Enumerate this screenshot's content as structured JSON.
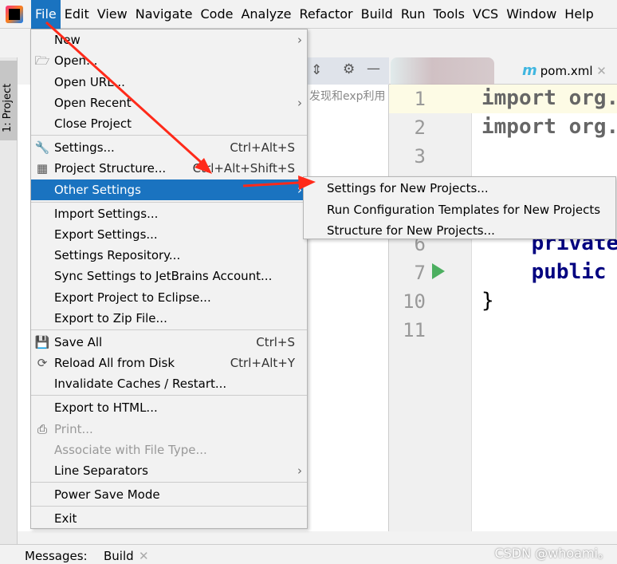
{
  "menubar": [
    "File",
    "Edit",
    "View",
    "Navigate",
    "Code",
    "Analyze",
    "Refactor",
    "Build",
    "Run",
    "Tools",
    "VCS",
    "Window",
    "Help"
  ],
  "sidebar": {
    "project_tab": "1: Project"
  },
  "panel": {
    "partial_text": "发现和exp利用"
  },
  "tabs": {
    "pom": "pom.xml",
    "pom_icon": "m"
  },
  "editor": {
    "line_numbers": [
      "1",
      "2",
      "3",
      "6",
      "7",
      "10",
      "11"
    ],
    "lines": {
      "l1": "import org.",
      "l2": "import org.",
      "l6": "    private",
      "l7": "    public",
      "l10": "}"
    }
  },
  "file_menu": [
    {
      "label": "New",
      "submenu": true
    },
    {
      "label": "Open...",
      "icon": "folder-open-icon"
    },
    {
      "label": "Open URL..."
    },
    {
      "label": "Open Recent",
      "submenu": true
    },
    {
      "label": "Close Project"
    },
    {
      "label": "Settings...",
      "shortcut": "Ctrl+Alt+S",
      "icon": "wrench-icon"
    },
    {
      "label": "Project Structure...",
      "shortcut": "Ctrl+Alt+Shift+S",
      "icon": "project-structure-icon"
    },
    {
      "label": "Other Settings",
      "submenu": true,
      "selected": true
    },
    {
      "label": "Import Settings..."
    },
    {
      "label": "Export Settings..."
    },
    {
      "label": "Settings Repository..."
    },
    {
      "label": "Sync Settings to JetBrains Account..."
    },
    {
      "label": "Export Project to Eclipse..."
    },
    {
      "label": "Export to Zip File..."
    },
    {
      "label": "Save All",
      "shortcut": "Ctrl+S",
      "icon": "save-icon"
    },
    {
      "label": "Reload All from Disk",
      "shortcut": "Ctrl+Alt+Y",
      "icon": "reload-icon"
    },
    {
      "label": "Invalidate Caches / Restart..."
    },
    {
      "label": "Export to HTML..."
    },
    {
      "label": "Print...",
      "disabled": true,
      "icon": "print-icon"
    },
    {
      "label": "Associate with File Type...",
      "disabled": true
    },
    {
      "label": "Line Separators",
      "submenu": true
    },
    {
      "label": "Power Save Mode"
    },
    {
      "label": "Exit"
    }
  ],
  "other_settings_submenu": [
    "Settings for New Projects...",
    "Run Configuration Templates for New Projects",
    "Structure for New Projects..."
  ],
  "bottom": {
    "messages": "Messages:",
    "build": "Build"
  },
  "watermark": "CSDN @whoami。",
  "colors": {
    "accent": "#1a73c0",
    "arrow": "#ff2a1a",
    "keyword": "#000080"
  }
}
